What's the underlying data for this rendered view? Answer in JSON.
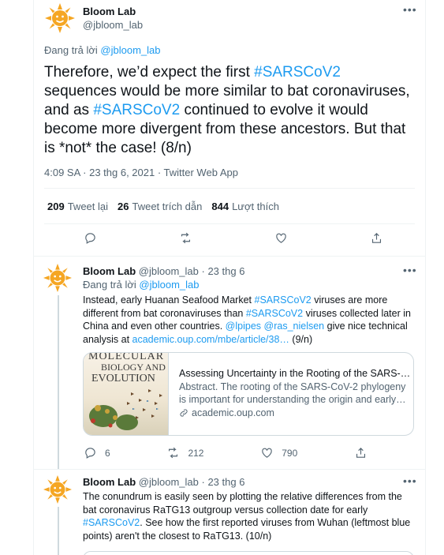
{
  "main_tweet": {
    "author_name": "Bloom Lab",
    "author_handle": "@jbloom_lab",
    "replying_prefix": "Đang trả lời",
    "replying_to": "@jbloom_lab",
    "text_parts": [
      "Therefore, we’d expect the first ",
      "#SARSCoV2",
      " sequences would be more similar to bat coronaviruses, and as ",
      "#SARSCoV2",
      " continued to evolve it would become more divergent from these ancestors. But that is *not* the case! (8/n)"
    ],
    "timestamp": "4:09 SA · 23 thg 6, 2021 · Twitter Web App",
    "stats": {
      "retweets_count": "209",
      "retweets_label": "Tweet lại",
      "quotes_count": "26",
      "quotes_label": "Tweet trích dẫn",
      "likes_count": "844",
      "likes_label": "Lượt thích"
    }
  },
  "replies": [
    {
      "author_name": "Bloom Lab",
      "author_handle": "@jbloom_lab",
      "date": "· 23 thg 6",
      "replying_prefix": "Đang trả lời",
      "replying_to": "@jbloom_lab",
      "text_parts": [
        "Instead, early Huanan Seafood Market ",
        "#SARSCoV2",
        " viruses are more different from bat coronaviruses than ",
        "#SARSCoV2",
        " viruses collected later in China and even other countries. ",
        "@lpipes",
        " ",
        "@ras_nielsen",
        " give nice technical analysis at ",
        "academic.oup.com/mbe/article/38…",
        " (9/n)"
      ],
      "card": {
        "image_text_line1": "MOLECULAR",
        "image_text_line2": "BIOLOGY AND",
        "image_text_line3": "EVOLUTION",
        "title": "Assessing Uncertainty in the Rooting of the SARS-…",
        "description": "Abstract. The rooting of the SARS-CoV-2 phylogeny is important for understanding the origin and early…",
        "domain": "academic.oup.com"
      },
      "reply_count": "6",
      "retweet_count": "212",
      "like_count": "790"
    },
    {
      "author_name": "Bloom Lab",
      "author_handle": "@jbloom_lab",
      "date": "· 23 thg 6",
      "text_parts": [
        "The conundrum is easily seen by plotting the relative differences from the bat coronavirus RaTG13 outgroup versus collection date for early ",
        "#SARSCoV2",
        ". See how the first reported viruses from Wuhan (leftmost blue points) aren't the closest to RaTG13. (10/n)"
      ]
    }
  ],
  "icons": {
    "more": "more-icon",
    "reply": "reply-icon",
    "retweet": "retweet-icon",
    "like": "heart-icon",
    "share": "share-icon",
    "link": "link-icon"
  },
  "colors": {
    "accent": "#1d9bf0",
    "text": "#0f1419",
    "muted": "#536471",
    "avatar_sun": "#f5a623"
  }
}
